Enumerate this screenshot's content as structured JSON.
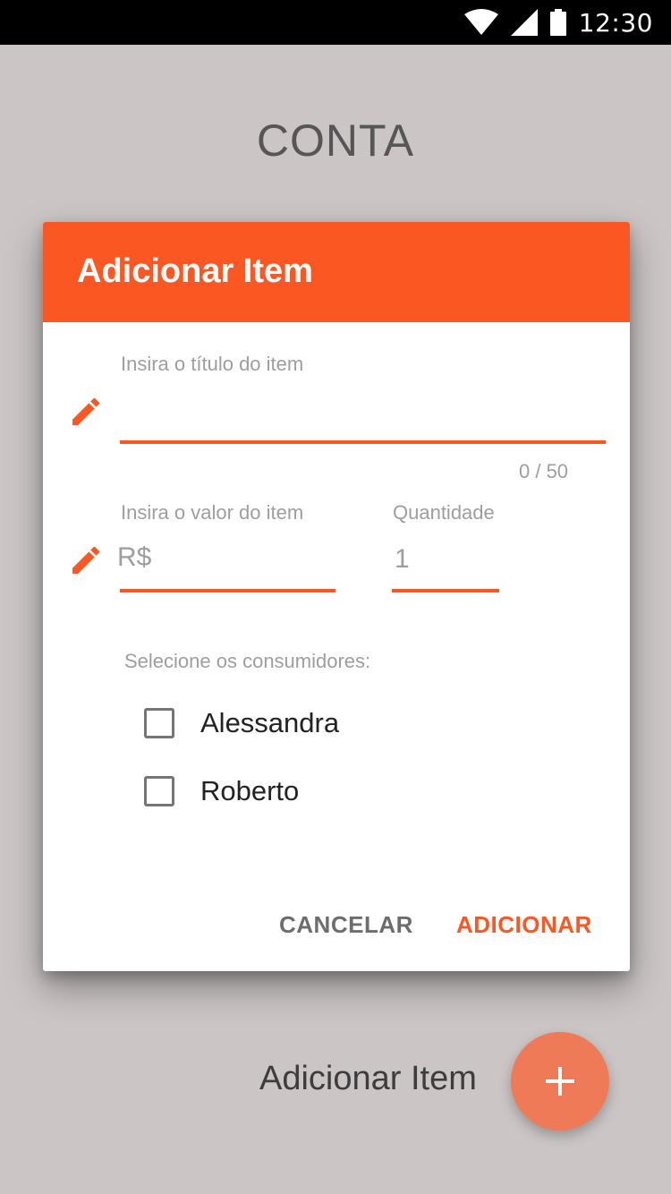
{
  "status_bar": {
    "time": "12:30",
    "icons": [
      "wifi-icon",
      "cell-signal-icon",
      "battery-icon"
    ]
  },
  "page": {
    "title": "CONTA",
    "bottom_label": "Adicionar Item",
    "fab_icon": "plus-icon"
  },
  "dialog": {
    "title": "Adicionar Item",
    "title_field": {
      "label": "Insira o título do item",
      "value": "",
      "counter": "0 / 50"
    },
    "value_field": {
      "label": "Insira o valor do item",
      "prefix": "R$"
    },
    "quantity_field": {
      "label": "Quantidade",
      "value": "1"
    },
    "consumers_label": "Selecione os consumidores:",
    "consumers": [
      {
        "name": "Alessandra",
        "checked": false
      },
      {
        "name": "Roberto",
        "checked": false
      }
    ],
    "cancel_label": "CANCELAR",
    "add_label": "ADICIONAR"
  },
  "colors": {
    "accent": "#fb5722",
    "background": "#cbc5c5",
    "fab": "#ee7a57"
  }
}
